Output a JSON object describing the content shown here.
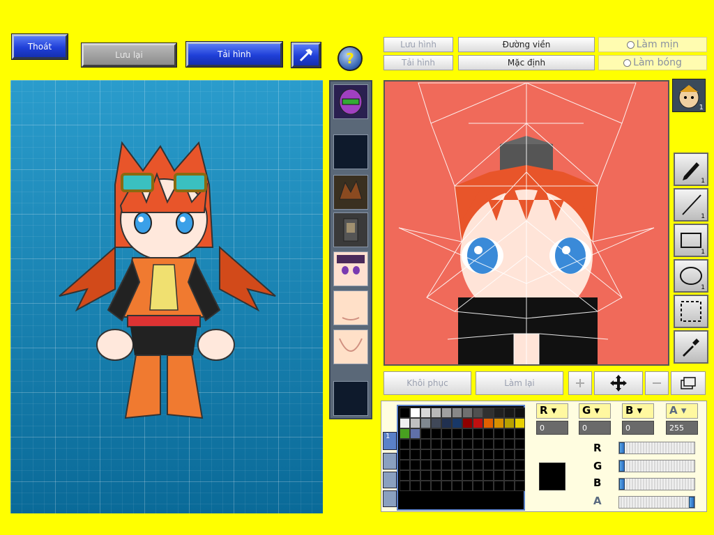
{
  "toolbar": {
    "exit_label": "Thoát",
    "save_label": "Lưu lại",
    "reload_label": "Tải hình",
    "help_label": "?"
  },
  "editor": {
    "save_image": "Lưu hình",
    "load_image": "Tải hình",
    "outline": "Đường viền",
    "default": "Mặc định",
    "smooth": "Làm mịn",
    "shading": "Làm bóng",
    "restore": "Khôi phục",
    "redo": "Làm lại"
  },
  "tools": [
    {
      "name": "pen",
      "count": "1"
    },
    {
      "name": "line",
      "count": "1"
    },
    {
      "name": "rectangle",
      "count": "1"
    },
    {
      "name": "ellipse",
      "count": "1"
    },
    {
      "name": "selection",
      "count": ""
    },
    {
      "name": "eyedropper",
      "count": ""
    }
  ],
  "face_badge": "1",
  "color": {
    "r_label": "R",
    "g_label": "G",
    "b_label": "B",
    "a_label": "A",
    "r": "0",
    "g": "0",
    "b": "0",
    "a": "255",
    "r_level": 0,
    "g_level": 0,
    "b_level": 0,
    "a_level": 1,
    "current": "#000000",
    "palette_tab": "1"
  },
  "palette": [
    "#000000",
    "#ffffff",
    "#d8d8d8",
    "#b8b8b8",
    "#a0a0a0",
    "#888888",
    "#707070",
    "#505050",
    "#303030",
    "#202020",
    "#181818",
    "#101010",
    "#f0f0f0",
    "#c0c0c0",
    "#808890",
    "#404858",
    "#203050",
    "#183868",
    "#900000",
    "#c01010",
    "#e06000",
    "#d89000",
    "#b8a000",
    "#e8d000",
    "#48a020",
    "#6070a8"
  ],
  "colors": {
    "background": "#ffff00",
    "canvas": "#f06a5a",
    "preview": "#1a8ab8"
  }
}
